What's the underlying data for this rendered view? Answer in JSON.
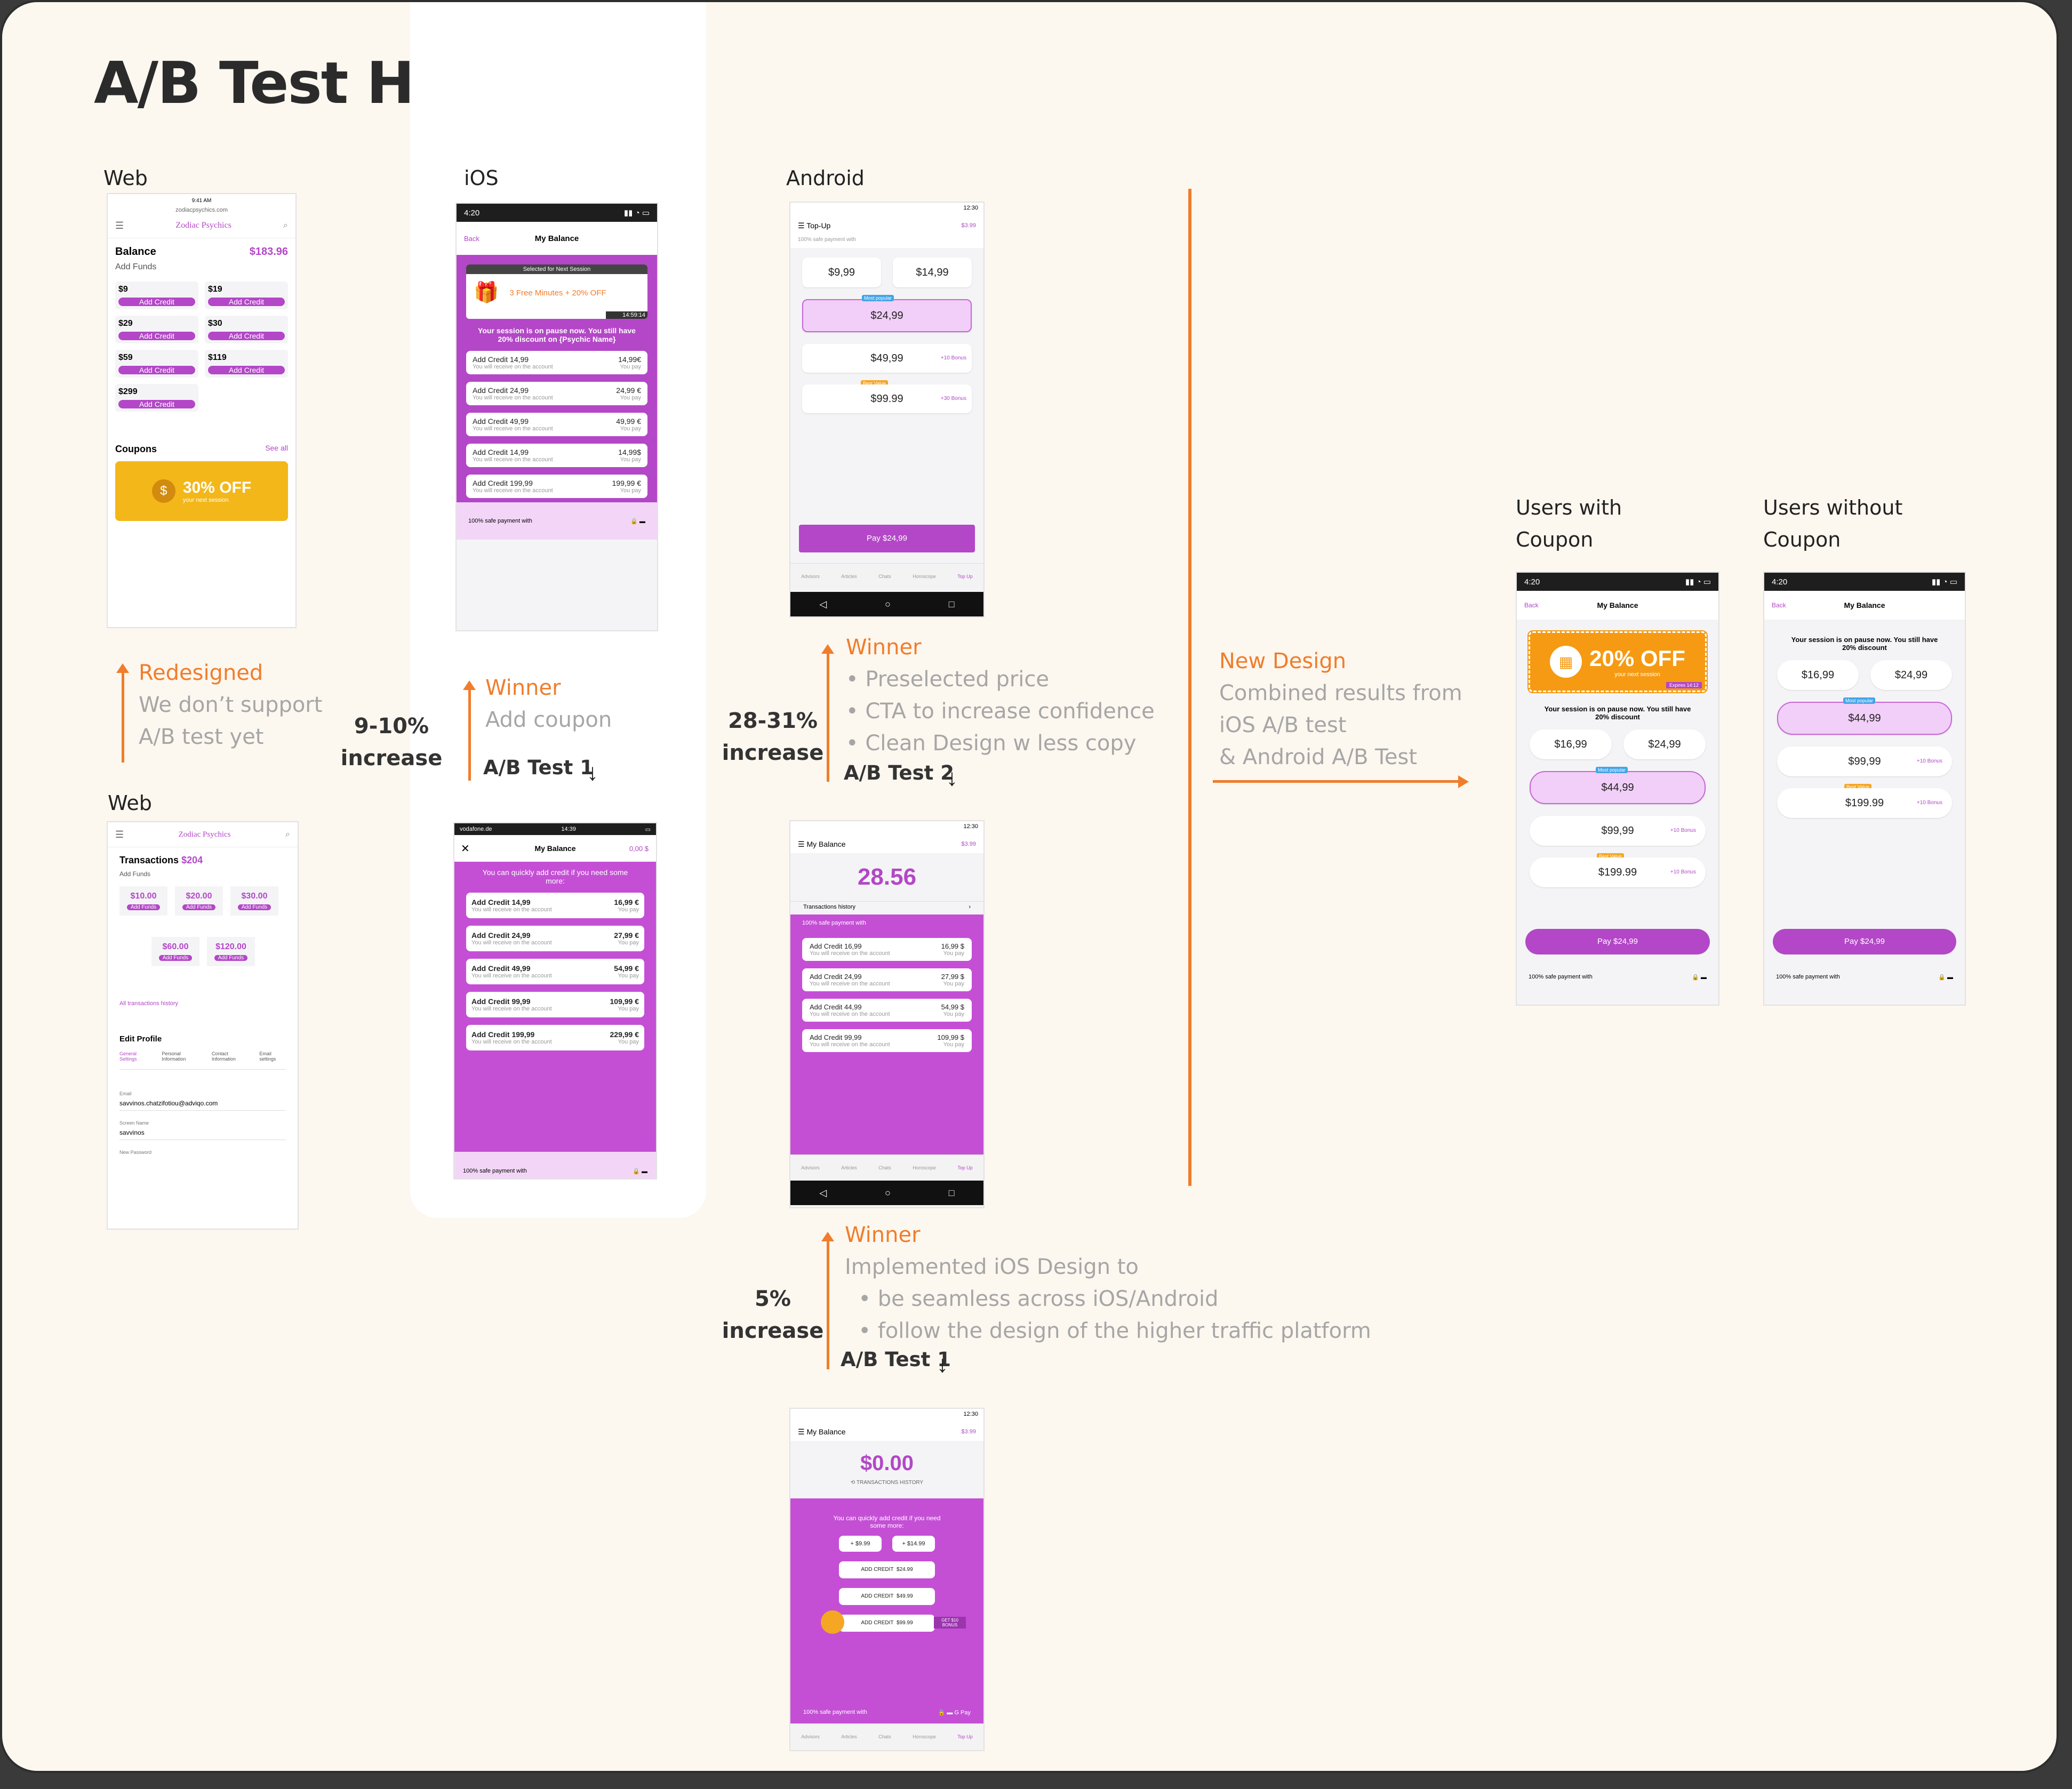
{
  "title": "A/B Test History",
  "labels": {
    "web": "Web",
    "ios": "iOS",
    "android": "Android",
    "web2": "Web",
    "with_coupon": "Users with Coupon",
    "without_coupon": "Users without Coupon"
  },
  "web_note": {
    "head": "Redesigned",
    "l1": "We don’t support",
    "l2": "A/B test yet"
  },
  "ios_note": {
    "head": "Winner",
    "l1": "Add coupon",
    "pct1": "9-10%",
    "pct2": "increase",
    "test": "A/B Test 1"
  },
  "android_note1": {
    "head": "Winner",
    "b1": "Preselected price",
    "b2": "CTA to increase confidence",
    "b3": "Clean Design w less copy",
    "pct1": "28-31%",
    "pct2": "increase",
    "test": "A/B Test 2"
  },
  "android_note2": {
    "head": "Winner",
    "l1": "Implemented iOS Design to",
    "b1": "be seamless across iOS/Android",
    "b2": "follow the design of the higher traffic platform",
    "pct1": "5%",
    "pct2": "increase",
    "test": "A/B Test 1"
  },
  "new_design": {
    "head": "New Design",
    "l1": "Combined results from",
    "l2": "iOS A/B test",
    "l3": "& Android A/B Test"
  },
  "web1": {
    "site": "Zodiac Psychics",
    "url": "zodiacpsychics.com",
    "time": "9:41 AM",
    "balance_label": "Balance",
    "balance": "$183.96",
    "add_funds": "Add Funds",
    "add_credit": "Add Credit",
    "prices": [
      "$9",
      "$19",
      "$29",
      "$30",
      "$59",
      "$119",
      "$299"
    ],
    "coupons": "Coupons",
    "see_all": "See all",
    "coupon_text": "30% OFF",
    "coupon_sub": "your next session"
  },
  "web2": {
    "site": "Zodiac Psychics",
    "transactions": "Transactions",
    "amount": "$204",
    "add_funds": "Add Funds",
    "prices": [
      "$10.00",
      "$20.00",
      "$30.00",
      "$60.00",
      "$120.00"
    ],
    "btn": "Add Funds",
    "history": "All transactions history",
    "edit_profile": "Edit Profile",
    "tabs": [
      "General Settings",
      "Personal Information",
      "Contact Information",
      "Email settings"
    ],
    "email_label": "Email",
    "email": "savvinos.chatzifotiou@adviqo.com",
    "screen_label": "Screen Name",
    "screen": "savvinos",
    "pw_label": "New Password"
  },
  "ios1": {
    "time": "4:20",
    "back": "Back",
    "title": "My Balance",
    "selected": "Selected for Next Session",
    "offer": "3 Free Minutes + 20% OFF",
    "timer": "14:59:14",
    "pause": "Your session is on pause now. You still have 20% discount on {Psychic Name}",
    "rows": [
      {
        "l": "Add Credit 14,99",
        "r": "14,99€"
      },
      {
        "l": "Add Credit 24,99",
        "r": "24,99 €"
      },
      {
        "l": "Add Credit 49,99",
        "r": "49,99 €"
      },
      {
        "l": "Add Credit 14,99",
        "r": "14,99$"
      },
      {
        "l": "Add Credit 199,99",
        "r": "199,99 €"
      }
    ],
    "sub": "You will receive on the account",
    "pay": "You pay",
    "safe": "100% safe payment with"
  },
  "ios2": {
    "carrier": "vodafone.de",
    "time": "14:39",
    "title": "My Balance",
    "bal": "0,00 $",
    "banner": "You can quickly add credit if you need some more:",
    "rows": [
      {
        "l": "Add Credit  14,99",
        "r": "16,99 €"
      },
      {
        "l": "Add Credit  24,99",
        "r": "27,99 €"
      },
      {
        "l": "Add Credit  49,99",
        "r": "54,99 €"
      },
      {
        "l": "Add Credit  99,99",
        "r": "109,99 €"
      },
      {
        "l": "Add Credit  199,99",
        "r": "229,99 €"
      }
    ],
    "sub": "You will receive on the account",
    "pay": "You pay",
    "safe": "100% safe payment with"
  },
  "and1": {
    "time": "12:30",
    "title": "Top-Up",
    "credit": "$3.99",
    "safe": "100% safe payment with",
    "p1": "$9,99",
    "p2": "$14,99",
    "popular": "Most popular",
    "p3": "$24,99",
    "p4": "$49,99",
    "p5": "$99.99",
    "bonus1": "+10 Bonus",
    "bonus2": "+30 Bonus",
    "best": "Best Value",
    "pay": "Pay $24,99",
    "tabs": [
      "Advisors",
      "Articles",
      "Chats",
      "Horoscope",
      "Top Up"
    ]
  },
  "and2": {
    "time": "12:30",
    "title": "My Balance",
    "credit": "$3.99",
    "balance": "28.56",
    "history": "Transactions history",
    "safe": "100% safe payment with",
    "rows": [
      {
        "l": "Add Credit 16,99",
        "r": "16,99 $"
      },
      {
        "l": "Add Credit 24,99",
        "r": "27,99 $"
      },
      {
        "l": "Add Credit 44,99",
        "r": "54,99 $"
      },
      {
        "l": "Add Credit 99,99",
        "r": "109,99 $"
      }
    ],
    "sub": "You will receive on the account",
    "pay": "You pay"
  },
  "and3": {
    "time": "12:30",
    "title": "My Balance",
    "credit": "$3.99",
    "balance": "$0.00",
    "history": "TRANSACTIONS HISTORY",
    "banner": "You can quickly add credit if you need some more:",
    "b1": "+ $9.99",
    "b2": "+ $14.99",
    "add": "ADD CREDIT",
    "v1": "$24.99",
    "v2": "$49.99",
    "v3": "$99.99",
    "bonus": "GET $10 BONUS",
    "safe": "100% safe payment with",
    "gpay": "G Pay"
  },
  "nd1": {
    "time": "4:20",
    "back": "Back",
    "title": "My Balance",
    "coupon": "20% OFF",
    "coupon_sub": "your next session",
    "expires": "Expires 14:12",
    "pause": "Your session is on pause now. You still have 20% discount",
    "p1": "$16,99",
    "p2": "$24,99",
    "popular": "Most popular",
    "p3": "$44,99",
    "p4": "$99,99",
    "p5": "$199.99",
    "bonus": "+10 Bonus",
    "best": "Best Value",
    "pay": "Pay $24,99",
    "safe": "100% safe payment with"
  },
  "nd2": {
    "time": "4:20",
    "back": "Back",
    "title": "My Balance",
    "pause": "Your session is on pause now. You still have 20% discount",
    "p1": "$16,99",
    "p2": "$24,99",
    "popular": "Most popular",
    "p3": "$44,99",
    "p4": "$99,99",
    "p5": "$199.99",
    "bonus": "+10 Bonus",
    "best": "Best Value",
    "pay": "Pay $24,99",
    "safe": "100% safe payment with"
  },
  "colors": {
    "purple": "#b347c7",
    "orange": "#f07d2b",
    "background": "#fcf7ef"
  }
}
